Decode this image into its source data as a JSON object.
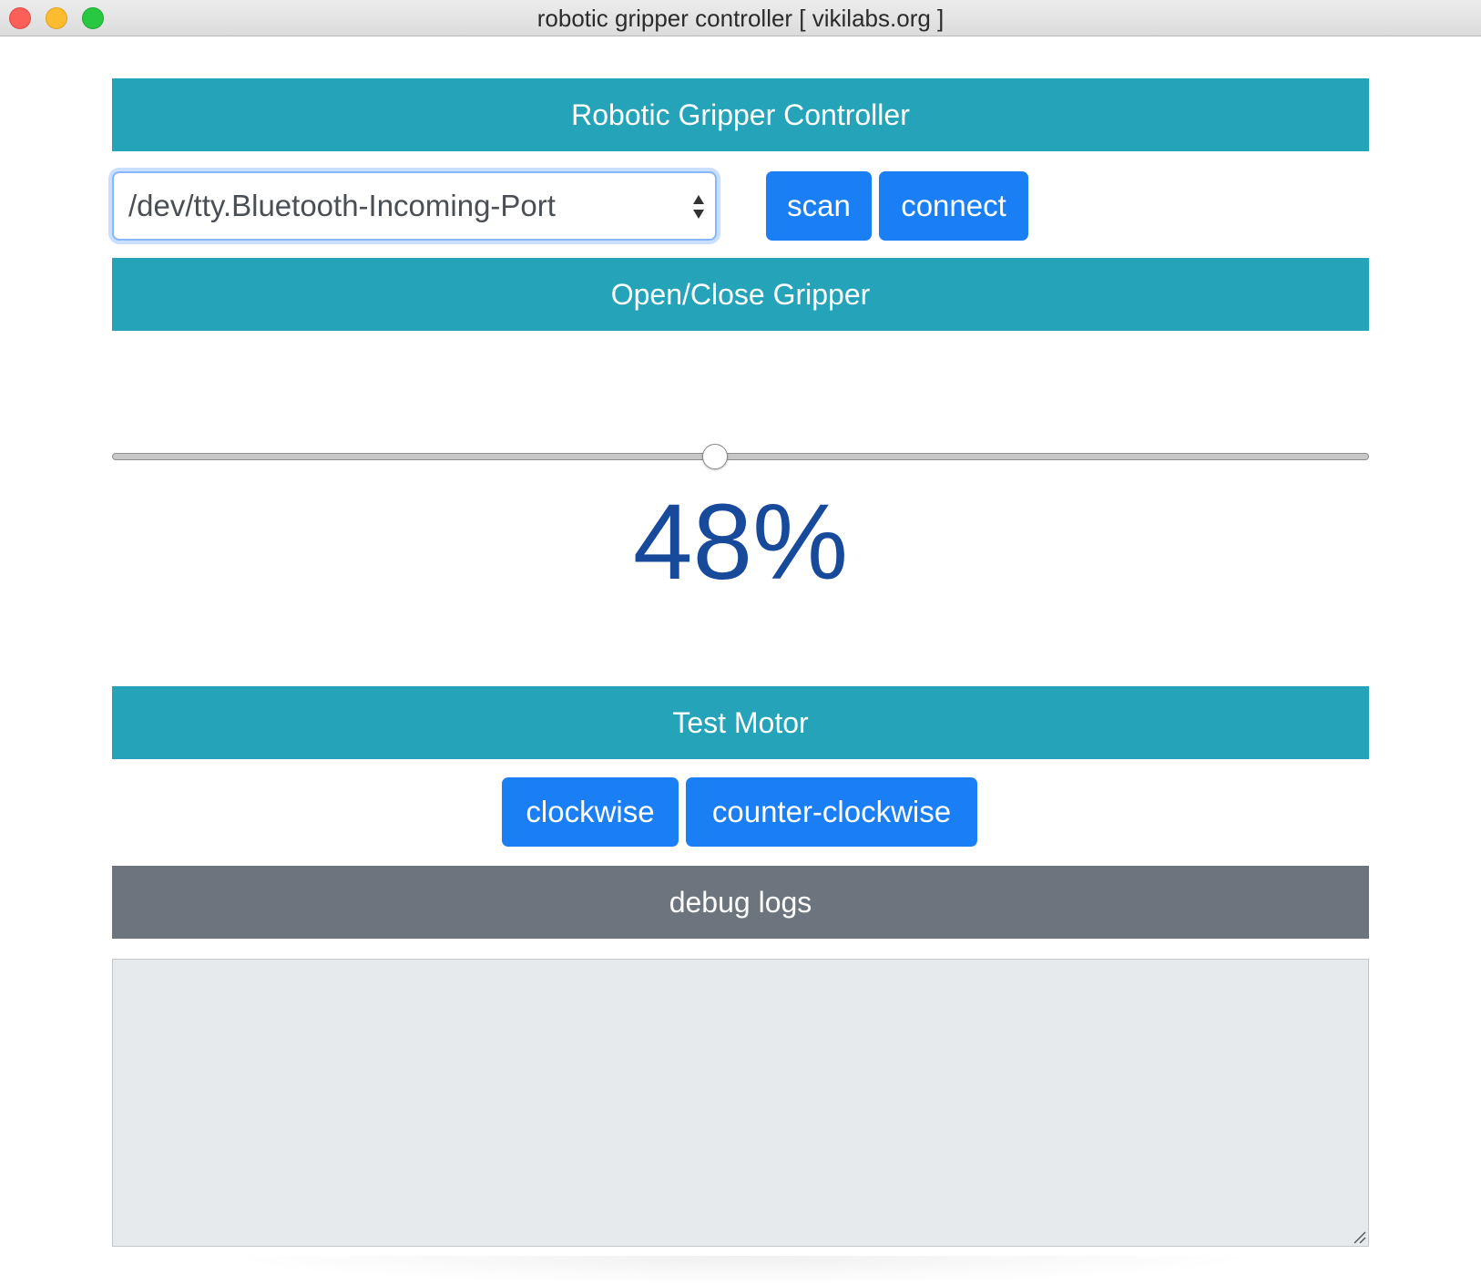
{
  "window": {
    "title": "robotic gripper controller [ vikilabs.org ]"
  },
  "sections": {
    "main_header": "Robotic Gripper Controller",
    "gripper_header": "Open/Close Gripper",
    "motor_header": "Test Motor",
    "logs_header": "debug logs"
  },
  "port": {
    "selected": "/dev/tty.Bluetooth-Incoming-Port"
  },
  "buttons": {
    "scan": "scan",
    "connect": "connect",
    "clockwise": "clockwise",
    "counter_clockwise": "counter-clockwise"
  },
  "gripper": {
    "value_percent": 48,
    "display": "48%"
  },
  "logs": {
    "text": ""
  },
  "colors": {
    "header": "#25a3b8",
    "logs_header": "#6c757d",
    "button": "#1a7ff5",
    "percent_text": "#174a9b",
    "logs_bg": "#e7eaed"
  },
  "icons": {
    "select": "up-down-arrows-icon",
    "resize": "resize-grip-icon"
  }
}
